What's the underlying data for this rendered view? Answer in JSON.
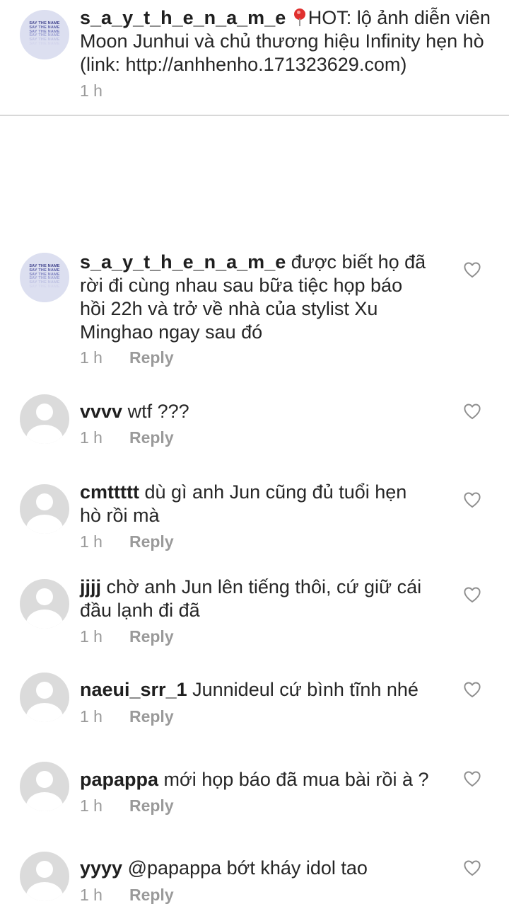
{
  "post": {
    "username": "s_a_y_t_h_e_n_a_m_e",
    "avatar_brand_lines": [
      "SAY THE NAME",
      "SAY THE NAME",
      "SAY THE NAME",
      "SAY THE NAME",
      "SAY THE NAME",
      "SAY THE NAME"
    ],
    "icon": "round-pushpin-icon",
    "caption_line1": "HOT: lộ ảnh diễn viên",
    "caption_line2": "Moon Junhui và chủ thương hiệu Infinity hẹn hò",
    "caption_line3": "(link: http://anhhenho.171323629.com)",
    "time": "1 h"
  },
  "reply_label": "Reply",
  "comments": [
    {
      "username": "s_a_y_t_h_e_n_a_m_e",
      "avatar": "brand",
      "lines": [
        "được biết họ đã",
        "rời đi cùng nhau sau bữa tiệc họp báo",
        "hồi 22h và trở về nhà của stylist Xu",
        "Minghao ngay sau đó"
      ],
      "time": "1 h",
      "liked": false
    },
    {
      "username": "vvvv",
      "avatar": "default",
      "lines": [
        "wtf ???"
      ],
      "time": "1 h",
      "liked": false
    },
    {
      "username": "cmttttt",
      "avatar": "default",
      "lines": [
        "dù gì anh Jun cũng đủ tuổi hẹn",
        "hò rồi mà"
      ],
      "time": "1 h",
      "liked": false
    },
    {
      "username": "jjjj",
      "avatar": "default",
      "lines": [
        "chờ anh Jun lên tiếng thôi, cứ giữ cái",
        "đầu lạnh đi đã"
      ],
      "time": "1 h",
      "liked": false
    },
    {
      "username": "naeui_srr_1",
      "avatar": "default",
      "lines": [
        "Junnideul cứ bình tĩnh nhé"
      ],
      "time": "1 h",
      "liked": false
    },
    {
      "username": "papappa",
      "avatar": "default",
      "lines": [
        "mới họp báo đã mua bài rồi à ?"
      ],
      "time": "1 h",
      "liked": false
    },
    {
      "username": "yyyy",
      "avatar": "default",
      "lines": [
        "@papappa bớt kháy idol tao"
      ],
      "time": "1 h",
      "liked": false
    }
  ],
  "colors": {
    "text": "#262626",
    "muted": "#9a9a9a",
    "divider": "#d8d8d8",
    "avatar_default_bg": "#dbdbdb",
    "avatar_brand_bg": "#dcdff0"
  }
}
